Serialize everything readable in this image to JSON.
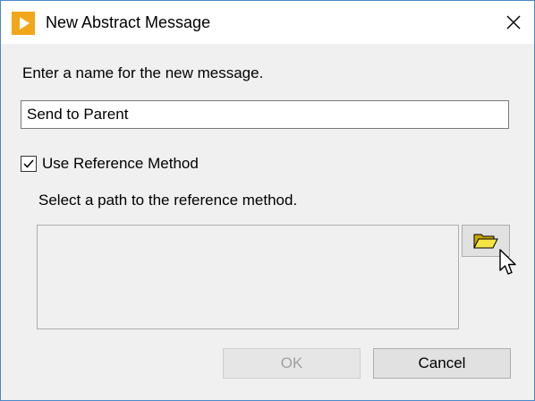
{
  "window": {
    "title": "New Abstract Message",
    "close_icon": "close-icon"
  },
  "form": {
    "name_prompt": "Enter a name for the new message.",
    "name_value": "Send to Parent",
    "use_reference_label": "Use Reference Method",
    "use_reference_checked": true,
    "path_prompt": "Select a path to the reference method.",
    "path_value": "",
    "browse_icon": "folder-open-icon"
  },
  "buttons": {
    "ok_label": "OK",
    "ok_enabled": false,
    "cancel_label": "Cancel"
  },
  "colors": {
    "accent": "#f5a623",
    "window_border": "#4a89c8"
  }
}
